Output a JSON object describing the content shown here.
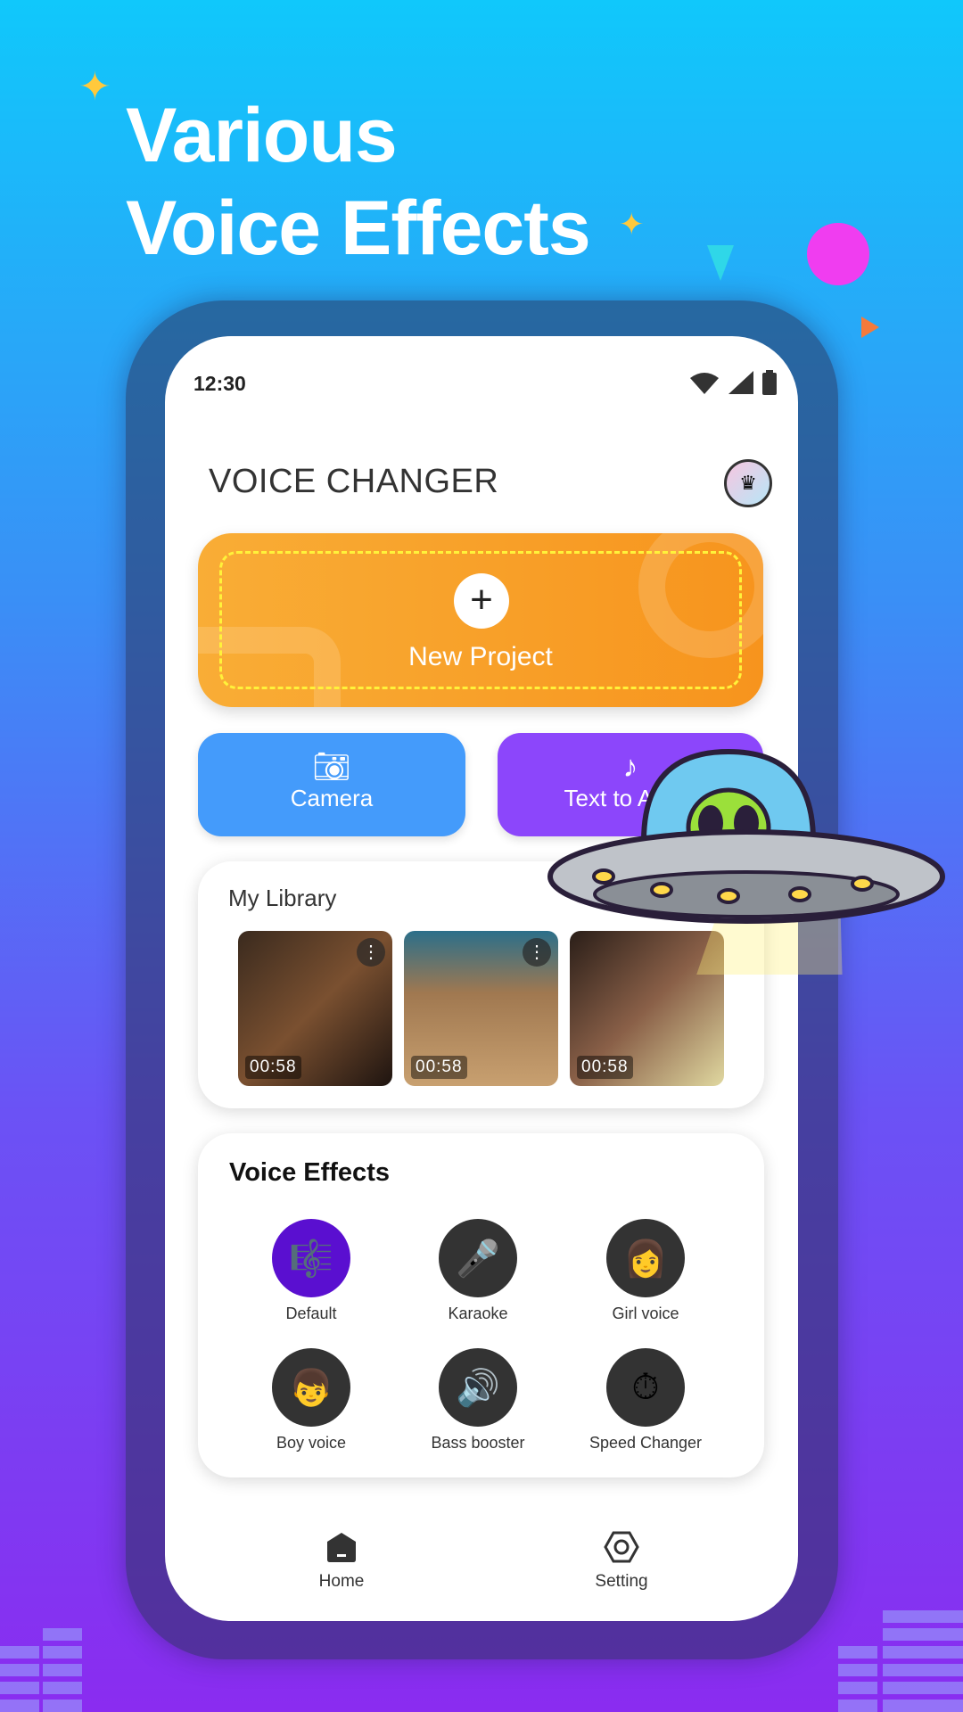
{
  "headline": {
    "line1": "Various",
    "line2": "Voice Effects"
  },
  "status": {
    "time": "12:30",
    "icons": [
      "wifi-icon",
      "signal-icon",
      "battery-icon"
    ]
  },
  "app": {
    "title": "VOICE CHANGER",
    "premium_icon": "crown-icon"
  },
  "new_project": {
    "label": "New Project",
    "icon": "plus-icon"
  },
  "actions": [
    {
      "label": "Camera",
      "icon": "camera-icon"
    },
    {
      "label": "Text to Audio",
      "icon": "music-note-icon"
    }
  ],
  "library": {
    "title": "My Library",
    "items": [
      {
        "duration": "00:58"
      },
      {
        "duration": "00:58"
      },
      {
        "duration": "00:58"
      }
    ]
  },
  "effects": {
    "title": "Voice Effects",
    "items": [
      {
        "label": "Default",
        "icon": "treble-clef-icon"
      },
      {
        "label": "Karaoke",
        "icon": "microphone-icon"
      },
      {
        "label": "Girl voice",
        "icon": "girl-icon"
      },
      {
        "label": "Boy voice",
        "icon": "boy-icon"
      },
      {
        "label": "Bass booster",
        "icon": "speaker-icon"
      },
      {
        "label": "Speed Changer",
        "icon": "stopwatch-icon"
      }
    ]
  },
  "nav": [
    {
      "label": "Home",
      "icon": "home-icon"
    },
    {
      "label": "Setting",
      "icon": "settings-icon"
    }
  ],
  "colors": {
    "orange": "#f7941d",
    "blue": "#449bfb",
    "purple": "#8c46fb"
  }
}
